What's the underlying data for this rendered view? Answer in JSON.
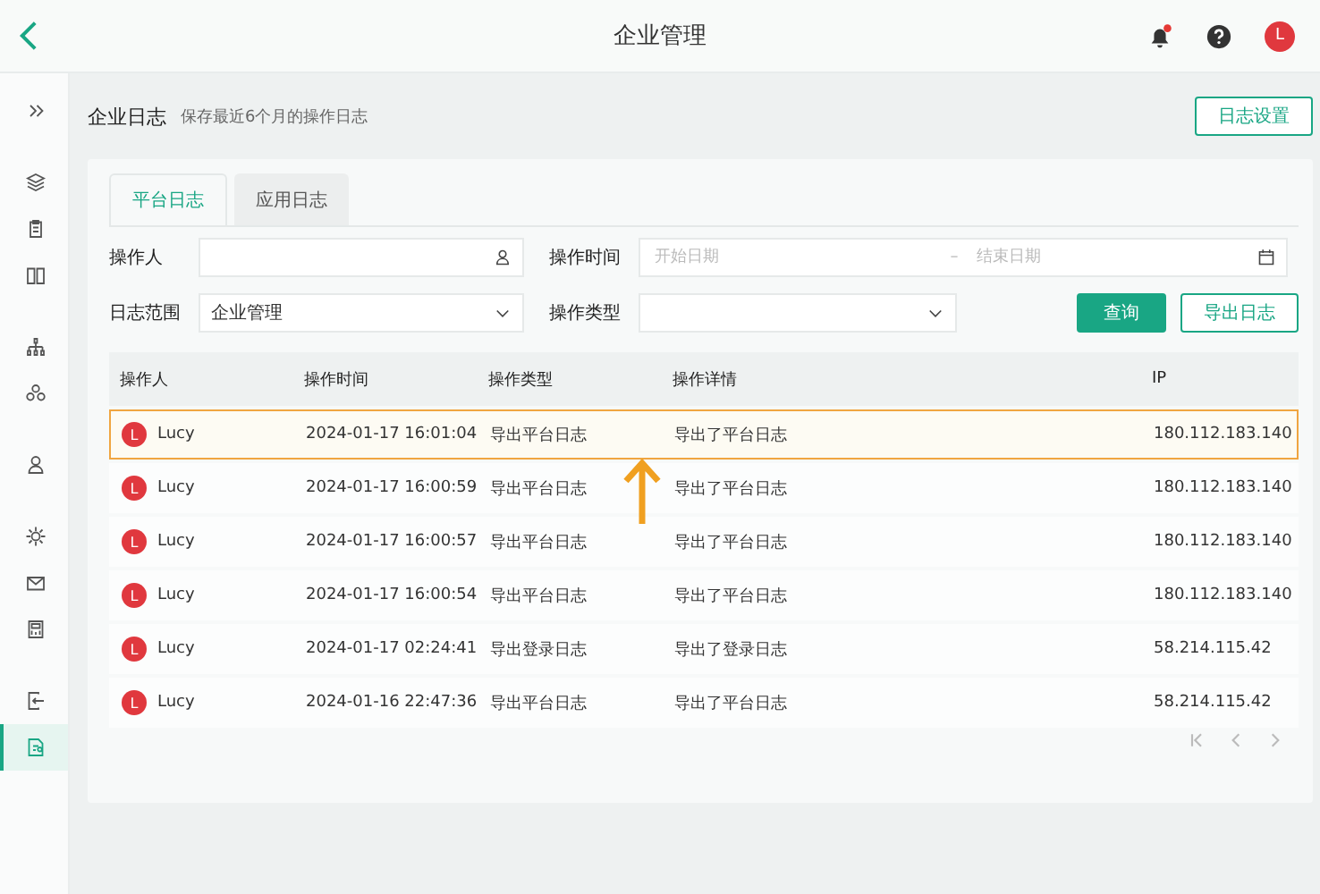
{
  "topbar": {
    "title": "企业管理",
    "notification_dot": true,
    "avatar": "L"
  },
  "sidebar": {
    "items": [
      {
        "selected": false
      },
      {
        "selected": false
      },
      {
        "selected": false
      },
      {
        "selected": false
      },
      {
        "selected": false
      },
      {
        "selected": false
      },
      {
        "selected": false
      },
      {
        "selected": false
      },
      {
        "selected": false
      },
      {
        "selected": false
      },
      {
        "selected": false
      },
      {
        "selected": true
      }
    ]
  },
  "page": {
    "title": "企业日志",
    "subtitle": "保存最近6个月的操作日志",
    "settings_button": "日志设置"
  },
  "tabs": [
    {
      "label": "平台日志",
      "selected": true
    },
    {
      "label": "应用日志",
      "selected": false
    }
  ],
  "filters": {
    "operator_label": "操作人",
    "time_label": "操作时间",
    "start_placeholder": "开始日期",
    "separator": "–",
    "end_placeholder": "结束日期",
    "scope_label": "日志范围",
    "scope_value": "企业管理",
    "type_label": "操作类型"
  },
  "buttons": {
    "query": "查询",
    "export": "导出日志"
  },
  "table": {
    "columns": [
      "操作人",
      "操作时间",
      "操作类型",
      "操作详情",
      "IP"
    ],
    "rows": [
      {
        "avatar": "L",
        "user": "Lucy",
        "time": "2024-01-17 16:01:04",
        "type": "导出平台日志",
        "detail": "导出了平台日志",
        "ip": "180.112.183.140",
        "highlighted": true
      },
      {
        "avatar": "L",
        "user": "Lucy",
        "time": "2024-01-17 16:00:59",
        "type": "导出平台日志",
        "detail": "导出了平台日志",
        "ip": "180.112.183.140",
        "highlighted": false
      },
      {
        "avatar": "L",
        "user": "Lucy",
        "time": "2024-01-17 16:00:57",
        "type": "导出平台日志",
        "detail": "导出了平台日志",
        "ip": "180.112.183.140",
        "highlighted": false
      },
      {
        "avatar": "L",
        "user": "Lucy",
        "time": "2024-01-17 16:00:54",
        "type": "导出平台日志",
        "detail": "导出了平台日志",
        "ip": "180.112.183.140",
        "highlighted": false
      },
      {
        "avatar": "L",
        "user": "Lucy",
        "time": "2024-01-17 02:24:41",
        "type": "导出登录日志",
        "detail": "导出了登录日志",
        "ip": "58.214.115.42",
        "highlighted": false
      },
      {
        "avatar": "L",
        "user": "Lucy",
        "time": "2024-01-16 22:47:36",
        "type": "导出平台日志",
        "detail": "导出了平台日志",
        "ip": "58.214.115.42",
        "highlighted": false
      }
    ]
  },
  "annotation": {
    "arrow": true
  }
}
